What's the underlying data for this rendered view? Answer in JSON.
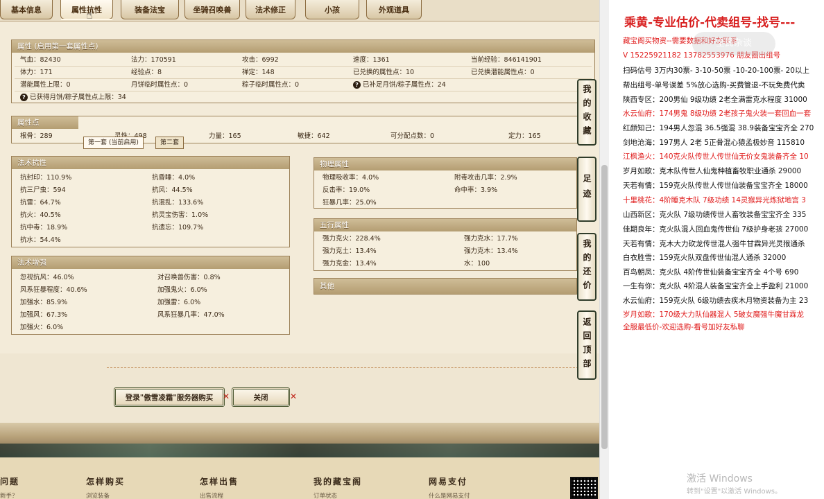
{
  "tabs": [
    "基本信息",
    "属性抗性",
    "装备法宝",
    "坐骑召唤兽",
    "法术修正",
    "小孩",
    "外观道具"
  ],
  "active_tab": "属性抗性",
  "attr": {
    "title": "属性 (启用第一套属性点)",
    "rows": [
      [
        "气血：82430",
        "法力：170591",
        "攻击：6992",
        "速度：1361",
        "当前经验：846141901"
      ],
      [
        "体力：171",
        "经验点：8",
        "禅定：148",
        "已兑换的属性点：10",
        "已兑换潜能属性点：0"
      ],
      [
        "潜能属性上限：0",
        "月饼临时属性点：0",
        "粽子临时属性点：0",
        "已补足月饼/粽子属性点：24",
        ""
      ]
    ],
    "note": "已获得月饼/粽子属性点上限：34"
  },
  "points": {
    "title": "属性点",
    "subtabs": [
      "第一套 (当前启用)",
      "第二套"
    ],
    "values": [
      "根骨：289",
      "灵性：498",
      "力量：165",
      "敏捷：642",
      "可分配点数：0",
      "定力：165"
    ]
  },
  "resist": {
    "title": "法术抗性",
    "items": [
      [
        "抗封印：110.9%",
        "抗昏睡：4.0%"
      ],
      [
        "抗三尸虫：594",
        "抗风：44.5%"
      ],
      [
        "抗雷：64.7%",
        "抗混乱：133.6%"
      ],
      [
        "抗火：40.5%",
        "抗灵宝伤害：1.0%"
      ],
      [
        "抗中毒：18.9%",
        "抗遗忘：109.7%"
      ],
      [
        "抗水：54.4%",
        ""
      ]
    ]
  },
  "enhance": {
    "title": "法术增强",
    "items": [
      [
        "忽视抗风：46.0%",
        "对召唤兽伤害：0.8%"
      ],
      [
        "风系狂暴程度：40.6%",
        "加强鬼火：6.0%"
      ],
      [
        "加强水：85.9%",
        "加强雷：6.0%"
      ],
      [
        "加强风：67.3%",
        "风系狂暴几率：47.0%"
      ],
      [
        "加强火：6.0%",
        ""
      ]
    ]
  },
  "physical": {
    "title": "物理属性",
    "items": [
      [
        "物理吸收率：4.0%",
        "附毒攻击几率：2.9%"
      ],
      [
        "反击率：19.0%",
        "命中率：3.9%"
      ],
      [
        "狂暴几率：25.0%",
        ""
      ]
    ]
  },
  "elements": {
    "title": "五行属性",
    "items": [
      [
        "强力克火：228.4%",
        "强力克水：17.7%"
      ],
      [
        "强力克土：13.4%",
        "强力克木：13.4%"
      ],
      [
        "强力克金：13.4%",
        "水：100"
      ]
    ]
  },
  "other": {
    "title": "其他"
  },
  "buttons": {
    "login": "登录\"傲雪凌霜\"服务器购买",
    "close": "关闭"
  },
  "side_buttons": [
    "我的收藏",
    "足迹",
    "我的还价",
    "返回顶部"
  ],
  "footer": {
    "headings": [
      "问题",
      "怎样购买",
      "怎样出售",
      "我的藏宝阁",
      "网易支付"
    ],
    "subs": [
      "新手？",
      "浏览装备",
      "出售流程",
      "订单状态",
      "什么是网易支付"
    ]
  },
  "ad": {
    "title": "乘黄-专业估价-代卖组号-找号---",
    "lines": [
      {
        "text": "藏宝阁买物资--需要数据和好友联系",
        "red": true
      },
      {
        "text": "V 15225921182  13782553976 朋友圈出组号",
        "red": true
      },
      {
        "text": "扫码估号 3万内30票- 3-10-50票  -10-20-100票- 20以上",
        "red": false
      },
      {
        "text": "帮出组号-单号误差 5%放心选购-买费管退-不玩免费代卖",
        "red": false
      },
      {
        "text": "陕西专区：200男仙 9级功绩 2老全满雷克水程度 31000",
        "red": false
      },
      {
        "text": "水云仙府：174男鬼 8级功绩 2老孩子鬼火装一套回血一套",
        "red": true
      },
      {
        "text": "红颜知己：194男人忽混 36.5强混 38.9装备宝宝齐全 270",
        "red": false
      },
      {
        "text": "剑地沧海：197男人 2老 5正骨混心猿孟极妙音 115810",
        "red": false
      },
      {
        "text": "江枫渔火：140克火队传世人传世仙无价女鬼装备齐全 10",
        "red": true
      },
      {
        "text": "岁月如歌：克木队传世人仙鬼种植畜牧职业通杀 29000",
        "red": false
      },
      {
        "text": "天若有情：159克火队传世人传世仙装备宝宝齐全 18000",
        "red": false
      },
      {
        "text": "十里桃花：4阶睡克木队 7级功绩 14灵猴异光炼狱地宫 3",
        "red": true
      },
      {
        "text": "山西新区：克火队 7级功绩传世人畜牧装备宝宝齐全 335",
        "red": false
      },
      {
        "text": "佳期良年：克火队混人回血鬼传世仙 7级护身老孩 27000",
        "red": false
      },
      {
        "text": "天若有情：克木大力砍龙传世混人强牛甘霖异光灵猴通杀",
        "red": false
      },
      {
        "text": "白衣胜雪：159克火队双盘传世仙混人通杀 32000",
        "red": false
      },
      {
        "text": "百鸟朝凤：克火队 4阶传世仙装备宝宝齐全 4个号 690",
        "red": false
      },
      {
        "text": "一生有你：克火队 4阶混人装备宝宝齐全上手盈利 21000",
        "red": false
      },
      {
        "text": "水云仙府：159克火队 6级功绩去疾木月物资装备为主 23",
        "red": false
      },
      {
        "text": "岁月如歌：170级大力队仙器混人 5破女魔强牛魔甘霖龙",
        "red": true
      },
      {
        "text": "全服最低价-欢迎选购-看号加好友私聊",
        "red": true
      }
    ],
    "watermark": "全民杂谈",
    "activation": "激活 Windows",
    "activation_sub": "转到\"设置\"以激活 Windows。"
  }
}
